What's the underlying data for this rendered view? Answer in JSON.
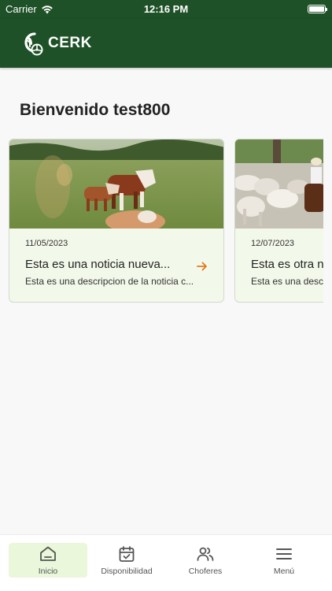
{
  "status_bar": {
    "carrier": "Carrier",
    "time": "12:16 PM"
  },
  "header": {
    "brand": "CERK"
  },
  "welcome": {
    "text": "Bienvenido test800"
  },
  "news": [
    {
      "date": "11/05/2023",
      "title": "Esta es una noticia nueva...",
      "description": "Esta es una descripcion de la noticia c..."
    },
    {
      "date": "12/07/2023",
      "title": "Esta es otra n",
      "description": "Esta es una desc"
    }
  ],
  "bottom_nav": [
    {
      "label": "Inicio",
      "icon": "home-icon",
      "active": true
    },
    {
      "label": "Disponibilidad",
      "icon": "calendar-check-icon",
      "active": false
    },
    {
      "label": "Choferes",
      "icon": "users-icon",
      "active": false
    },
    {
      "label": "Menú",
      "icon": "hamburger-menu-icon",
      "active": false
    }
  ],
  "colors": {
    "primary": "#1e5127",
    "card_bg": "#f3f9ea",
    "accent_arrow": "#e07a1f",
    "nav_active_bg": "#eaf7db"
  }
}
